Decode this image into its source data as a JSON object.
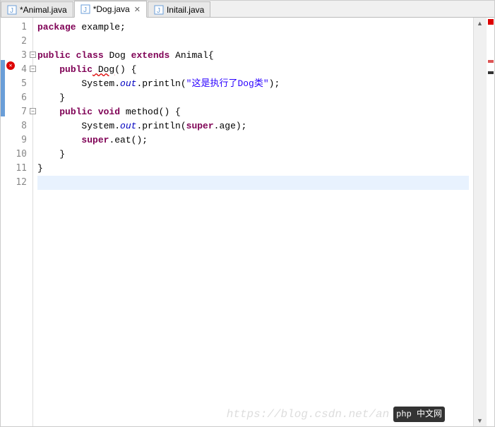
{
  "tabs": [
    {
      "label": "*Animal.java",
      "active": false
    },
    {
      "label": "*Dog.java",
      "active": true
    },
    {
      "label": "Initail.java",
      "active": false
    }
  ],
  "lineNumbers": [
    "1",
    "2",
    "3",
    "4",
    "5",
    "6",
    "7",
    "8",
    "9",
    "10",
    "11",
    "12"
  ],
  "code": {
    "l1_kw1": "package",
    "l1_rest": " example;",
    "l3_kw1": "public",
    "l3_kw2": "class",
    "l3_cls": " Dog ",
    "l3_kw3": "extends",
    "l3_sup": " Animal{",
    "l4_indent": "    ",
    "l4_kw1": "public",
    "l4_ctor": " Dog",
    "l4_rest": "() {",
    "l5_indent": "        ",
    "l5_sys": "System.",
    "l5_out": "out",
    "l5_call": ".println(",
    "l5_str": "\"这是执行了Dog类\"",
    "l5_end": ");",
    "l6_indent": "    ",
    "l6_brace": "}",
    "l7_indent": "    ",
    "l7_kw1": "public",
    "l7_kw2": " void",
    "l7_name": " method() {",
    "l8_indent": "        ",
    "l8_sys": "System.",
    "l8_out": "out",
    "l8_call": ".println(",
    "l8_kw": "super",
    "l8_rest": ".age);",
    "l9_indent": "        ",
    "l9_kw": "super",
    "l9_rest": ".eat();",
    "l10_indent": "    ",
    "l10_brace": "}",
    "l11_brace": "}"
  },
  "watermark": {
    "text": "https://blog.csdn.net/an",
    "brand1": "php",
    "brand2": "中文网"
  }
}
